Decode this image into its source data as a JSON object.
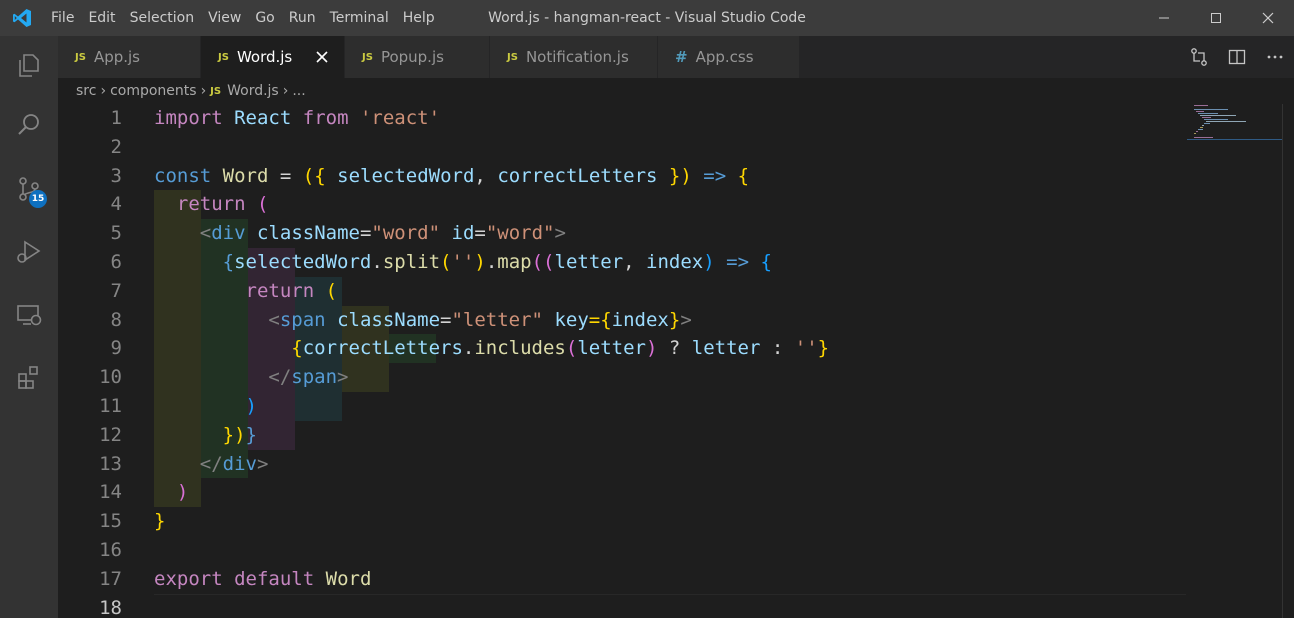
{
  "window": {
    "title": "Word.js - hangman-react - Visual Studio Code",
    "menu": [
      "File",
      "Edit",
      "Selection",
      "View",
      "Go",
      "Run",
      "Terminal",
      "Help"
    ]
  },
  "activity_bar": {
    "items": [
      "explorer-icon",
      "search-icon",
      "source-control-icon",
      "run-debug-icon",
      "remote-explorer-icon",
      "extensions-icon"
    ],
    "source_control_badge": "15"
  },
  "tabs": [
    {
      "label": "App.js",
      "icon": "JS",
      "active": false
    },
    {
      "label": "Word.js",
      "icon": "JS",
      "active": true
    },
    {
      "label": "Popup.js",
      "icon": "JS",
      "active": false
    },
    {
      "label": "Notification.js",
      "icon": "JS",
      "active": false
    },
    {
      "label": "App.css",
      "icon": "#",
      "active": false
    }
  ],
  "breadcrumb": {
    "parts": [
      "src",
      "components"
    ],
    "file_icon": "JS",
    "file": "Word.js",
    "more": "..."
  },
  "editor": {
    "line_numbers": [
      "1",
      "2",
      "3",
      "4",
      "5",
      "6",
      "7",
      "8",
      "9",
      "10",
      "11",
      "12",
      "13",
      "14",
      "15",
      "16",
      "17",
      "18"
    ],
    "current_line": "18",
    "code": {
      "l1": [
        "import",
        "React",
        "from",
        "'react'"
      ],
      "l3": [
        "const",
        "Word",
        "=",
        "({",
        "selectedWord",
        ",",
        "correctLetters",
        "})",
        "=>",
        "{"
      ],
      "l4": [
        "return",
        "("
      ],
      "l5": [
        "<",
        "div",
        "className",
        "=",
        "\"word\"",
        "id",
        "=",
        "\"word\"",
        ">"
      ],
      "l6": [
        "{",
        "selectedWord",
        ".",
        "split",
        "(",
        "''",
        ")",
        ".",
        "map",
        "((",
        "letter",
        ", ",
        "index",
        ")",
        "=>",
        "{"
      ],
      "l7": [
        "return",
        "("
      ],
      "l8": [
        "<",
        "span",
        "className",
        "=",
        "\"letter\"",
        "key",
        "={",
        "index",
        "}",
        ">"
      ],
      "l9": [
        "{",
        "correctLetters",
        ".",
        "includes",
        "(",
        "letter",
        ")",
        "?",
        "letter",
        ":",
        "''",
        "}"
      ],
      "l10": [
        "</",
        "span",
        ">"
      ],
      "l11": [
        ")"
      ],
      "l12": [
        "})",
        "}"
      ],
      "l13": [
        "</",
        "div",
        ">"
      ],
      "l14": [
        ")"
      ],
      "l15": [
        "}"
      ],
      "l17": [
        "export",
        "default",
        "Word"
      ]
    }
  },
  "colors": {
    "keyword": "#c586c0",
    "storage": "#569cd6",
    "function": "#dcdcaa",
    "variable": "#9cdcfe",
    "string": "#ce9178",
    "bracket1": "#ffd700",
    "bracket2": "#da70d6",
    "bracket3": "#179fff"
  }
}
